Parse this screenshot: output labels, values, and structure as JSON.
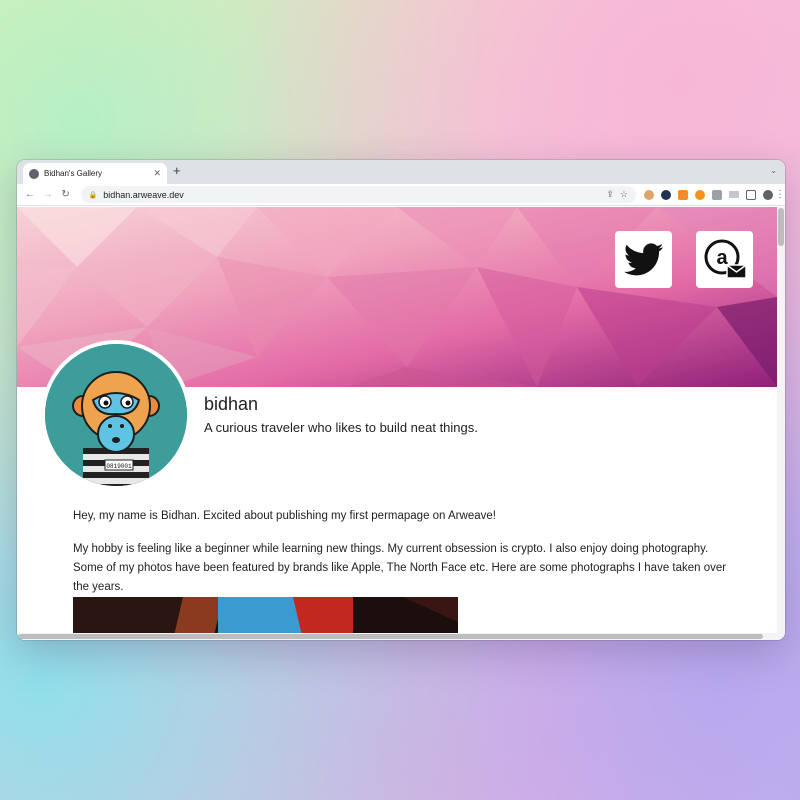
{
  "browser": {
    "tab_title": "Bidhan's Gallery",
    "tab_close": "✕",
    "new_tab": "+",
    "tab_search": "⌄",
    "back": "←",
    "forward": "→",
    "reload": "↻",
    "lock": "🔒",
    "url": "bidhan.arweave.dev",
    "menu": "⋮",
    "colors": {
      "tabstrip": "#dee1e6",
      "omnibox": "#f1f3f4"
    }
  },
  "profile": {
    "name": "bidhan",
    "tagline": "A curious traveler who likes to build neat things.",
    "avatar_badge": "0819001"
  },
  "social": {
    "twitter_icon": "twitter-bird-icon",
    "arweave_mail_icon": "arweave-mail-icon"
  },
  "content": {
    "intro": "Hey, my name is Bidhan. Excited about publishing my first permapage on Arweave!",
    "hobby": "My hobby is feeling like a beginner while learning new things. My current obsession is crypto. I also enjoy doing photography. Some of my photos have been featured by brands like Apple, The North Face etc. Here are some photographs I have taken over the years."
  },
  "theme": {
    "banner_colors": [
      "#f3c4cf",
      "#ee8fb4",
      "#d8508f",
      "#a42c7a",
      "#6a1a5e"
    ],
    "avatar_bg": "#3c9d9b"
  }
}
